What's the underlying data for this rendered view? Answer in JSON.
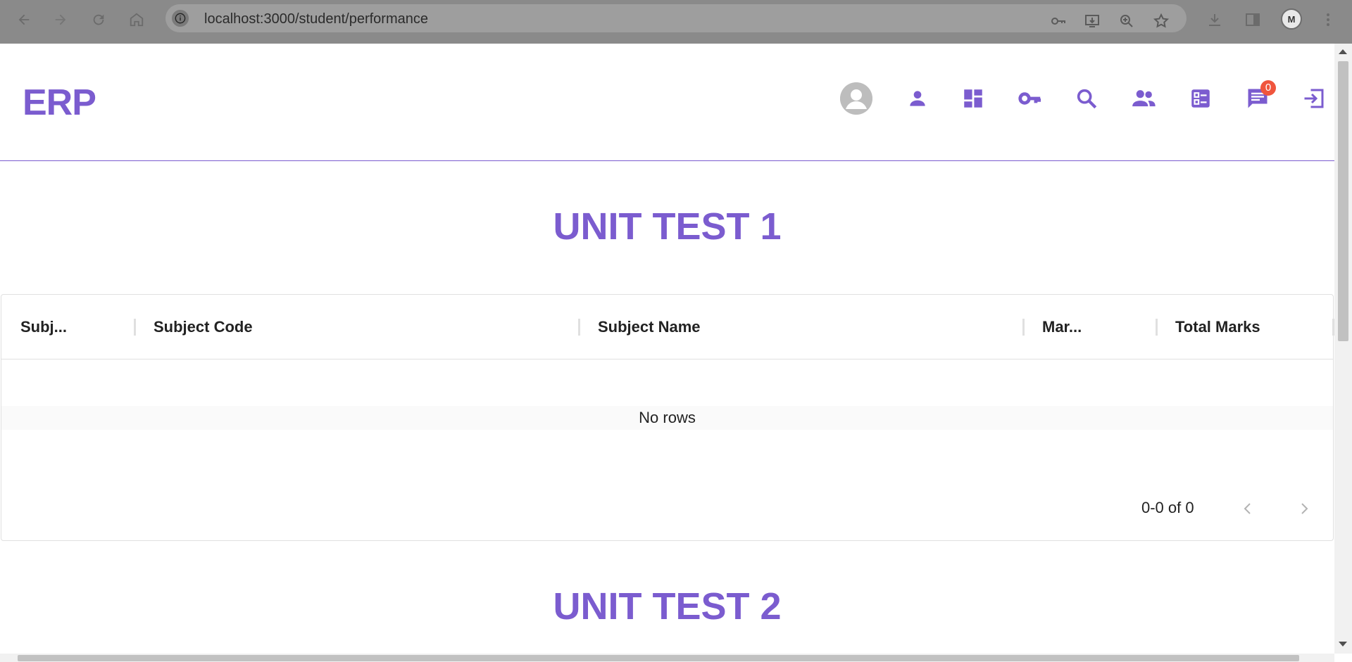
{
  "browser": {
    "url": "localhost:3000/student/performance",
    "profile_initials": "M",
    "icons": [
      "back-arrow-icon",
      "forward-arrow-icon",
      "reload-icon",
      "home-icon",
      "site-info-icon",
      "password-key-icon",
      "install-app-icon",
      "zoom-icon",
      "bookmark-star-icon",
      "download-icon",
      "side-panel-icon",
      "more-menu-icon"
    ]
  },
  "header": {
    "logo": "ERP",
    "accent_color": "#7b5ccf",
    "icons": [
      "avatar",
      "person-icon",
      "dashboard-icon",
      "key-icon",
      "search-icon",
      "group-icon",
      "list-icon",
      "chat-icon",
      "logout-icon"
    ],
    "notification_count": "0",
    "badge_color": "#f0553d"
  },
  "sections": [
    {
      "title": "UNIT TEST 1",
      "columns": [
        "Subj...",
        "Subject Code",
        "Subject Name",
        "Mar...",
        "Total Marks"
      ],
      "empty_text": "No rows",
      "pagination": "0-0 of 0"
    },
    {
      "title": "UNIT TEST 2"
    }
  ]
}
